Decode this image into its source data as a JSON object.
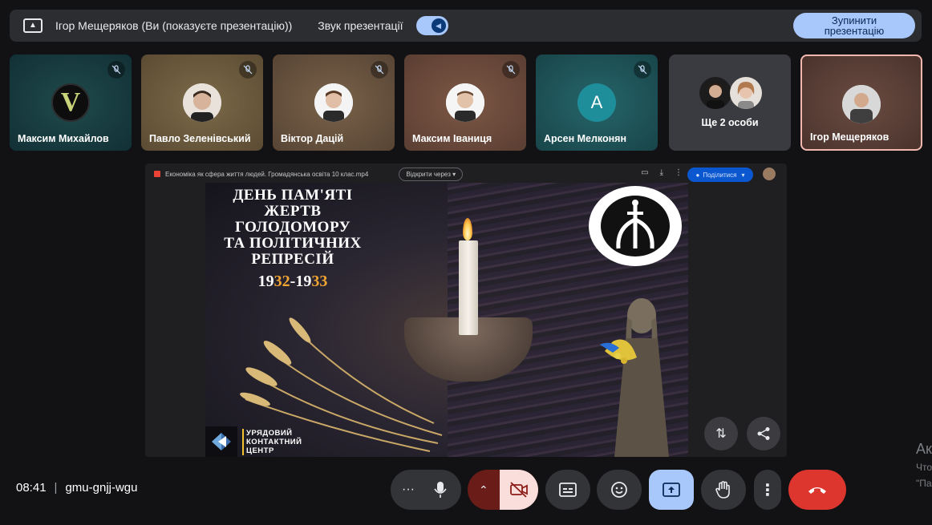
{
  "banner": {
    "presenter_text": "Ігор Мещеряков (Ви (показуєте презентацію))",
    "sound_label": "Звук презентації",
    "stop_label": "Зупинити презентацію"
  },
  "tiles": [
    {
      "name": "Максим Михайлов",
      "bg": "#15363a",
      "avatar_letter": "V",
      "muted": true
    },
    {
      "name": "Павло Зеленівський",
      "bg": "#6b5a3d",
      "muted": true
    },
    {
      "name": "Віктор Дацій",
      "bg": "#6a533e",
      "muted": true
    },
    {
      "name": "Максим Іваниця",
      "bg": "#6e4a3c",
      "muted": true
    },
    {
      "name": "Арсен Мелконян",
      "bg": "#1d4f55",
      "avatar_letter": "A",
      "muted": true
    },
    {
      "name": "Ще 2 особи",
      "bg": "#3a3b40"
    },
    {
      "name": "Ігор Мещеряков",
      "bg": "#5a4038",
      "active": true
    }
  ],
  "stage": {
    "file_name": "Економіка як сфера життя людей. Громадянська освіта 10 клас.mp4",
    "open_with": "Відкрити через ▾",
    "share": "Поділитися",
    "slide": {
      "title_lines": [
        "ДЕНЬ ПАМ'ЯТІ",
        "ЖЕРТВ",
        "ГОЛОДОМОРУ",
        "ТА ПОЛІТИЧНИХ",
        "РЕПРЕСІЙ"
      ],
      "years_a": "19",
      "years_b": "32",
      "years_c": "-19",
      "years_d": "33",
      "logo_lines": [
        "УРЯДОВИЙ",
        "КОНТАКТНИЙ",
        "ЦЕНТР"
      ]
    }
  },
  "bottom": {
    "time": "08:41",
    "separator": "|",
    "meeting_code": "gmu-gnjj-wgu"
  },
  "partial_right": [
    "Ак",
    "Что",
    "\"Па"
  ],
  "colors": {
    "accent": "#a8c7fa",
    "end_call": "#dc362e",
    "camera_off": "#f9dedc"
  }
}
